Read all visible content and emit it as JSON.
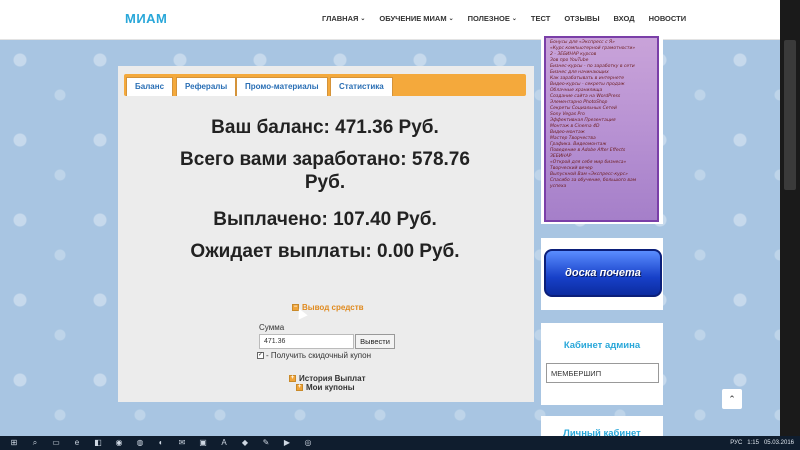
{
  "nav": {
    "brand": "МИАМ",
    "items": [
      {
        "label": "ГЛАВНАЯ",
        "caret": true
      },
      {
        "label": "ОБУЧЕНИЕ МИАМ",
        "caret": true
      },
      {
        "label": "ПОЛЕЗНОЕ",
        "caret": true
      },
      {
        "label": "ТЕСТ",
        "caret": false
      },
      {
        "label": "ОТЗЫВЫ",
        "caret": false
      },
      {
        "label": "ВХОД",
        "caret": false
      },
      {
        "label": "НОВОСТИ",
        "caret": false
      }
    ],
    "caret_glyph": "⌄"
  },
  "tabs": [
    {
      "label": "Баланс",
      "active": true
    },
    {
      "label": "Рефералы",
      "active": false
    },
    {
      "label": "Промо-материалы",
      "active": false
    },
    {
      "label": "Статистика",
      "active": false
    }
  ],
  "balance": {
    "line1": "Ваш баланс: 471.36 Руб.",
    "line2a": "Всего вами заработано: 578.76",
    "line2b": "Руб.",
    "line3": "Выплачено: 107.40 Руб.",
    "line4": "Ожидает выплаты: 0.00 Руб."
  },
  "withdraw": {
    "toggle_label": "Вывод средств",
    "sum_label": "Сумма",
    "amount_value": "471.36",
    "button_label": "Вывести",
    "coupon_label": "- Получить скидочный купон",
    "coupon_checked": true
  },
  "links": {
    "my_coupons": "Мои купоны",
    "history": "История Выплат"
  },
  "sidebar": {
    "promo_lines": [
      "Бонусы для «Экспресс с Я»",
      "«Курс компьютерной грамотности»",
      "2 - ЗЕБИНАР курсов",
      "Зов про YouTube",
      "Бизнес-курсы - по заработку в сети",
      "Бизнес для начинающих",
      "Как зарабатывать в интернете",
      "Видео-курсы - секреты продаж",
      "Облачные хранилища",
      "Создание сайта на WordPress",
      "Элементарно PhotoShop",
      "Секреты Социальных Сетей",
      "Sony Vegas Pro",
      "Эффективная Презентация",
      "Монтаж в Cinema 4D",
      "Видео-монтаж",
      "Мастер Творчества",
      "Графика. Видеомонтаж",
      "Поведение в Adobe After Effects",
      "ЗЕБИНАР",
      "«Открой для себя мир бизнеса»",
      "Творческий вечер",
      "Выпускной Вам «Экспресс-курс»",
      "Спасибо за обучение, большого вам успеха"
    ],
    "honor_label": "доска почета",
    "admin_title": "Кабинет админа",
    "admin_input_value": "МЕМБЕРШИП",
    "personal_title": "Личный кабинет",
    "scroll_top_glyph": "⌃"
  },
  "taskbar": {
    "icons": [
      "⊞",
      "⌕",
      "▭",
      "e",
      "◧",
      "◉",
      "◍",
      "◐",
      "✉",
      "▣",
      "A",
      "◆",
      "✎",
      "▶",
      "◎"
    ],
    "lang": "РУС",
    "time": "1:15",
    "date": "05.03.2016"
  },
  "colors": {
    "accent": "#29a7d9",
    "tabs_bar": "#f4a93c",
    "honor_button": "#1740c8"
  }
}
